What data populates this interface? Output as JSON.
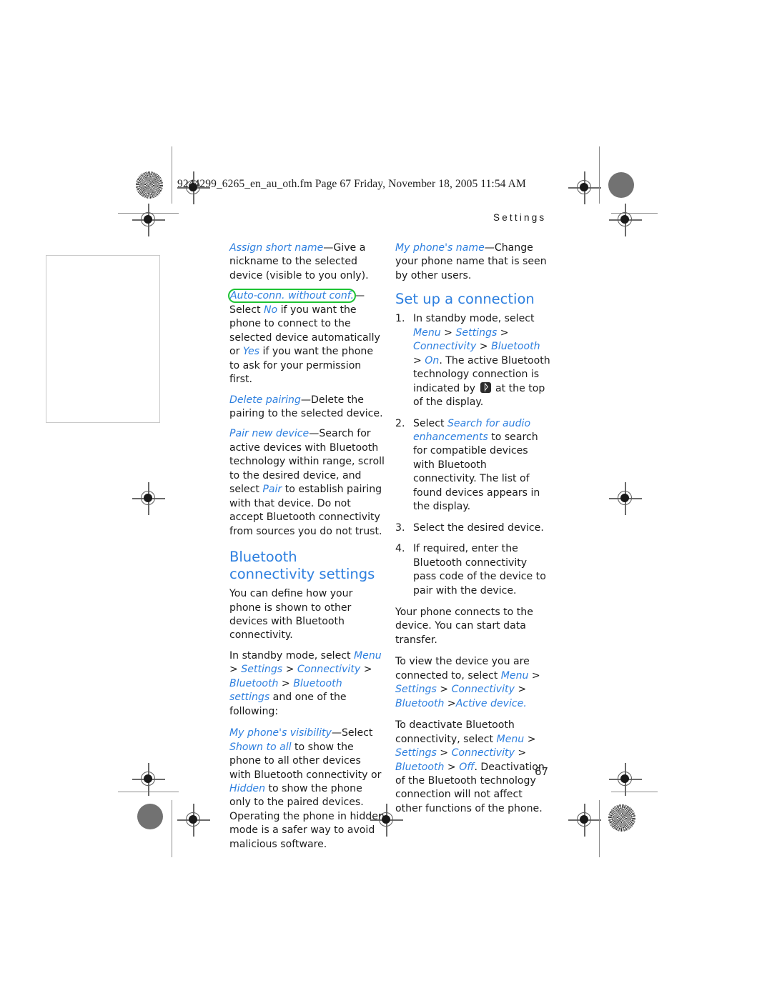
{
  "document": {
    "slug_line": "9244299_6265_en_au_oth.fm  Page 67  Friday, November 18, 2005  11:54 AM",
    "running_header": "Settings",
    "page_number": "67",
    "colors": {
      "link_blue": "#2d7fdf",
      "heading_blue": "#2d7fdf",
      "annotation_green": "#1ec334",
      "body_text": "#1b1b1b"
    }
  },
  "left_column": {
    "assign_short_name": {
      "term": "Assign short name",
      "body": "—Give a nickname to the selected device (visible to you only)."
    },
    "auto_conn": {
      "term": "Auto-conn. without conf.",
      "highlighted": true,
      "part1": "—Select ",
      "value1": "No",
      "part2": " if you want the phone to connect to the selected device automatically or ",
      "value2": "Yes",
      "part3": " if you want the phone to ask for your permission first."
    },
    "delete_pairing": {
      "term": "Delete pairing",
      "body": "—Delete the pairing to the selected device."
    },
    "pair_new_device": {
      "term": "Pair new device",
      "part1": "—Search for active devices with Bluetooth technology within range, scroll to the desired device, and select ",
      "value1": "Pair",
      "part2": " to establish pairing with that device. Do not accept Bluetooth connectivity from sources you do not trust."
    },
    "heading": "Bluetooth connectivity settings",
    "intro": "You can define how your phone is shown to other devices with Bluetooth connectivity.",
    "nav": {
      "lead": "In standby mode, select ",
      "menu": "Menu",
      "sep1": " > ",
      "settings": "Settings",
      "sep2": " > ",
      "connectivity": "Connectivity",
      "sep3": " > ",
      "bluetooth": "Bluetooth",
      "sep4": " > ",
      "bluetooth_settings": "Bluetooth settings",
      "tail": " and one of the following:"
    },
    "visibility": {
      "term": "My phone's visibility",
      "part1": "—Select ",
      "value1": "Shown to all",
      "part2": " to show the phone to all other devices with Bluetooth connectivity or ",
      "value2": "Hidden",
      "part3": " to show the phone only to the paired devices. Operating the phone in hidden mode is a safer way to avoid malicious software."
    }
  },
  "right_column": {
    "phone_name": {
      "term": "My phone's name",
      "body": "—Change your phone name that is seen by other users."
    },
    "heading": "Set up a connection",
    "steps": [
      {
        "num": "1.",
        "lead": "In standby mode, select ",
        "menu": "Menu",
        "sep1": " > ",
        "settings": "Settings",
        "sep2": " > ",
        "connectivity": "Connectivity",
        "sep3": " > ",
        "bluetooth": "Bluetooth",
        "sep4": " > ",
        "on": "On",
        "tail_a": ". The active Bluetooth technology connection is indicated by ",
        "icon": "bluetooth-icon",
        "tail_b": " at the top of the display."
      },
      {
        "num": "2.",
        "lead": "Select ",
        "value": "Search for audio enhancements",
        "tail": " to search for compatible devices with Bluetooth connectivity. The list of found devices appears in the display."
      },
      {
        "num": "3.",
        "lead": "Select the desired device."
      },
      {
        "num": "4.",
        "lead": "If required, enter the Bluetooth connectivity pass code of the device to pair with the device."
      }
    ],
    "connects": "Your phone connects to the device. You can start data transfer.",
    "view_device": {
      "lead": "To view the device you are connected to, select ",
      "menu": "Menu",
      "sep1": " > ",
      "settings": "Settings",
      "sep2": " > ",
      "connectivity": "Connectivity",
      "sep3": " > ",
      "bluetooth": "Bluetooth",
      "sep4": " >",
      "active_device": "Active device",
      "tail": "."
    },
    "deactivate": {
      "lead": "To deactivate Bluetooth connectivity, select ",
      "menu": "Menu",
      "sep1": " > ",
      "settings": "Settings",
      "sep2": " > ",
      "connectivity": "Connectivity",
      "sep3": " > ",
      "bluetooth": "Bluetooth",
      "sep4": " > ",
      "off": "Off",
      "tail": ". Deactivation of the Bluetooth technology connection will not affect other functions of the phone."
    }
  }
}
